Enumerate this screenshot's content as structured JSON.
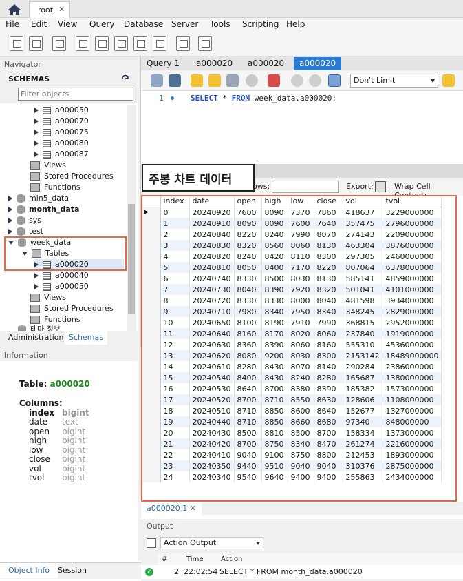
{
  "titlebar": {
    "connection_tab": "root",
    "close_glyph": "✕"
  },
  "menu": [
    "File",
    "Edit",
    "View",
    "Query",
    "Database",
    "Server",
    "Tools",
    "Scripting",
    "Help"
  ],
  "navigator": {
    "header": "Navigator",
    "schemas_label": "SCHEMAS",
    "filter_placeholder": "Filter objects",
    "tree": [
      {
        "label": "a000050",
        "kind": "table",
        "indent": 2
      },
      {
        "label": "a000070",
        "kind": "table",
        "indent": 2
      },
      {
        "label": "a000075",
        "kind": "table",
        "indent": 2
      },
      {
        "label": "a000080",
        "kind": "table",
        "indent": 2
      },
      {
        "label": "a000087",
        "kind": "table",
        "indent": 2
      },
      {
        "label": "Views",
        "kind": "group",
        "indent": 1
      },
      {
        "label": "Stored Procedures",
        "kind": "group",
        "indent": 1
      },
      {
        "label": "Functions",
        "kind": "group",
        "indent": 1
      },
      {
        "label": "min5_data",
        "kind": "db",
        "indent": 0
      },
      {
        "label": "month_data",
        "kind": "db",
        "indent": 0,
        "bold": true
      },
      {
        "label": "sys",
        "kind": "db",
        "indent": 0
      },
      {
        "label": "test",
        "kind": "db",
        "indent": 0
      },
      {
        "label": "week_data",
        "kind": "db",
        "indent": 0,
        "open": true
      },
      {
        "label": "Tables",
        "kind": "tables",
        "indent": 1,
        "open": true
      },
      {
        "label": "a000020",
        "kind": "table",
        "indent": 2,
        "selected": true
      },
      {
        "label": "a000040",
        "kind": "table",
        "indent": 2
      },
      {
        "label": "a000050",
        "kind": "table",
        "indent": 2
      },
      {
        "label": "Views",
        "kind": "group",
        "indent": 1
      },
      {
        "label": "Stored Procedures",
        "kind": "group",
        "indent": 1
      },
      {
        "label": "Functions",
        "kind": "group",
        "indent": 1
      },
      {
        "label": "테마 정보",
        "kind": "db",
        "indent": 0
      }
    ],
    "admin_tabs": [
      "Administration",
      "Schemas"
    ]
  },
  "information": {
    "header": "Information",
    "table_label": "Table:",
    "table_name": "a000020",
    "columns_label": "Columns:",
    "columns": [
      {
        "name": "index",
        "type": "bigint"
      },
      {
        "name": "date",
        "type": "text"
      },
      {
        "name": "open",
        "type": "bigint"
      },
      {
        "name": "high",
        "type": "bigint"
      },
      {
        "name": "low",
        "type": "bigint"
      },
      {
        "name": "close",
        "type": "bigint"
      },
      {
        "name": "vol",
        "type": "bigint"
      },
      {
        "name": "tvol",
        "type": "bigint"
      }
    ],
    "bottom_tabs": [
      "Object Info",
      "Session"
    ]
  },
  "query_tabs": [
    "Query 1",
    "a000020",
    "a000020",
    "a000020"
  ],
  "query_toolbar": {
    "limit": "Don't Limit"
  },
  "editor": {
    "line": "1",
    "sql_kw1": "SELECT",
    "sql_star": " * ",
    "sql_kw2": "FROM",
    "sql_rest": " week_data.a000020;"
  },
  "overlay_title": "주봉 차트 데이터",
  "result_bar": {
    "rows_label": "ows:",
    "export_label": "Export:",
    "wrap_label": "Wrap Cell Content:"
  },
  "grid": {
    "columns": [
      "index",
      "date",
      "open",
      "high",
      "low",
      "close",
      "vol",
      "tvol"
    ],
    "rows": [
      [
        "0",
        "20240920",
        "7600",
        "8090",
        "7370",
        "7860",
        "418637",
        "3229000000"
      ],
      [
        "1",
        "20240910",
        "8090",
        "8090",
        "7600",
        "7640",
        "357475",
        "2796000000"
      ],
      [
        "2",
        "20240840",
        "8220",
        "8240",
        "7990",
        "8070",
        "274143",
        "2209000000"
      ],
      [
        "3",
        "20240830",
        "8320",
        "8560",
        "8060",
        "8130",
        "463304",
        "3876000000"
      ],
      [
        "4",
        "20240820",
        "8240",
        "8420",
        "8110",
        "8300",
        "297305",
        "2460000000"
      ],
      [
        "5",
        "20240810",
        "8050",
        "8400",
        "7170",
        "8220",
        "807064",
        "6378000000"
      ],
      [
        "6",
        "20240740",
        "8330",
        "8500",
        "8030",
        "8130",
        "585141",
        "4859000000"
      ],
      [
        "7",
        "20240730",
        "8040",
        "8390",
        "7920",
        "8320",
        "501041",
        "4101000000"
      ],
      [
        "8",
        "20240720",
        "8330",
        "8330",
        "8000",
        "8040",
        "481598",
        "3934000000"
      ],
      [
        "9",
        "20240710",
        "7980",
        "8340",
        "7950",
        "8340",
        "348245",
        "2829000000"
      ],
      [
        "10",
        "20240650",
        "8100",
        "8190",
        "7910",
        "7990",
        "368815",
        "2952000000"
      ],
      [
        "11",
        "20240640",
        "8160",
        "8170",
        "8020",
        "8060",
        "237840",
        "1919000000"
      ],
      [
        "12",
        "20240630",
        "8360",
        "8390",
        "8060",
        "8160",
        "555310",
        "4536000000"
      ],
      [
        "13",
        "20240620",
        "8080",
        "9200",
        "8030",
        "8300",
        "2153142",
        "18489000000"
      ],
      [
        "14",
        "20240610",
        "8280",
        "8430",
        "8070",
        "8140",
        "290284",
        "2386000000"
      ],
      [
        "15",
        "20240540",
        "8400",
        "8430",
        "8240",
        "8280",
        "165687",
        "1380000000"
      ],
      [
        "16",
        "20240530",
        "8640",
        "8700",
        "8380",
        "8390",
        "185382",
        "1573000000"
      ],
      [
        "17",
        "20240520",
        "8700",
        "8710",
        "8550",
        "8630",
        "128606",
        "1108000000"
      ],
      [
        "18",
        "20240510",
        "8710",
        "8850",
        "8600",
        "8640",
        "152677",
        "1327000000"
      ],
      [
        "19",
        "20240440",
        "8710",
        "8850",
        "8660",
        "8680",
        "97340",
        "848000000"
      ],
      [
        "20",
        "20240430",
        "8500",
        "8810",
        "8500",
        "8700",
        "158334",
        "1373000000"
      ],
      [
        "21",
        "20240420",
        "8700",
        "8750",
        "8340",
        "8470",
        "261274",
        "2216000000"
      ],
      [
        "22",
        "20240410",
        "9040",
        "9100",
        "8750",
        "8800",
        "212453",
        "1893000000"
      ],
      [
        "23",
        "20240350",
        "9440",
        "9510",
        "9040",
        "9040",
        "310376",
        "2875000000"
      ],
      [
        "24",
        "20240340",
        "9540",
        "9640",
        "9400",
        "9400",
        "255863",
        "2434000000"
      ]
    ]
  },
  "result_tab": "a000020 1",
  "output": {
    "header": "Output",
    "selector": "Action Output",
    "col_num": "#",
    "col_time": "Time",
    "col_action": "Action",
    "row_num": "2",
    "row_time": "22:02:54",
    "row_action": "SELECT * FROM month_data.a000020"
  }
}
